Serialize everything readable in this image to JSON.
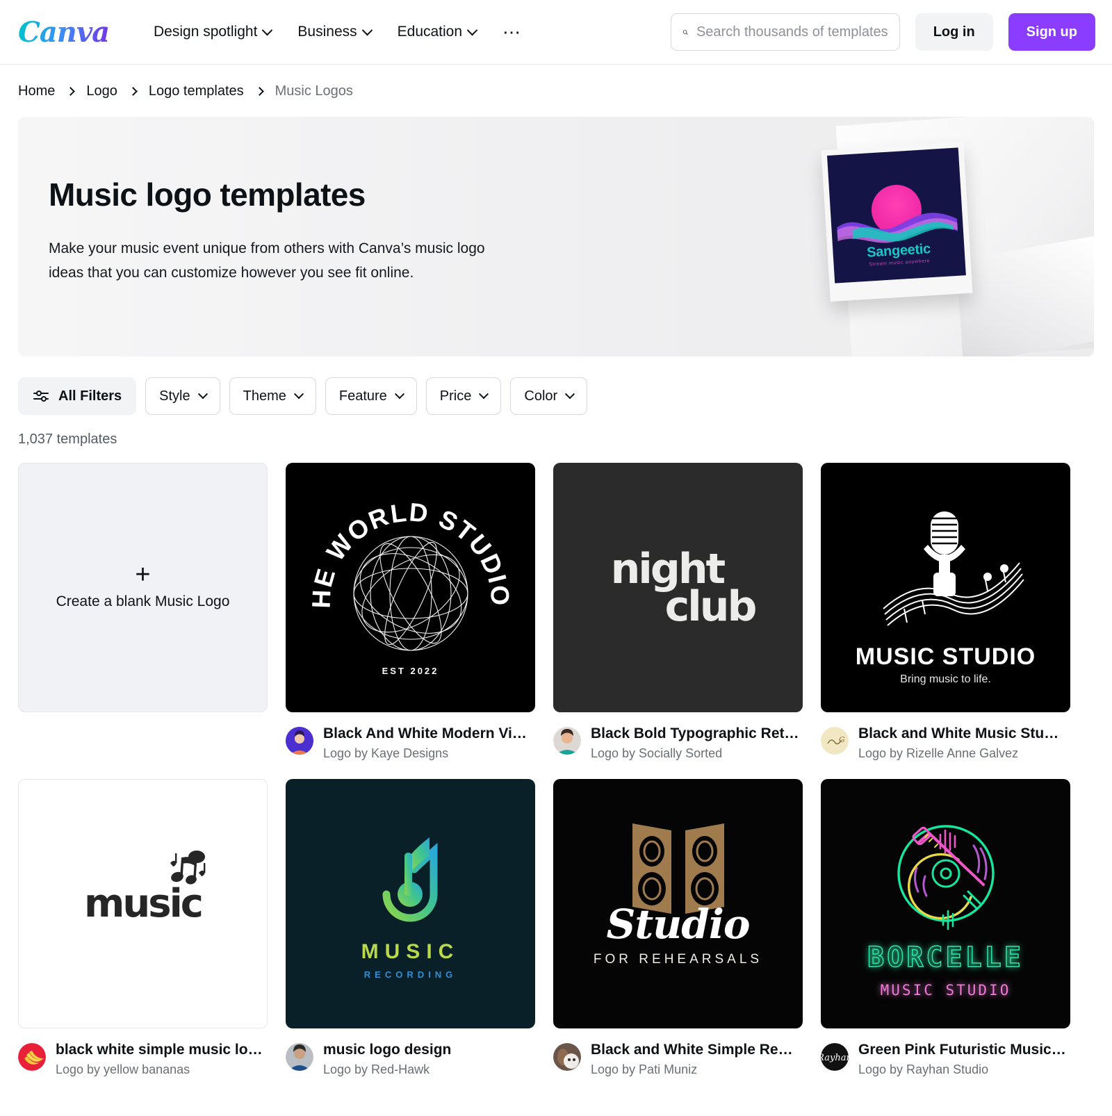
{
  "header": {
    "logo_text": "Canva",
    "nav": [
      {
        "label": "Design spotlight",
        "icon": "chevron-down-icon"
      },
      {
        "label": "Business",
        "icon": "chevron-down-icon"
      },
      {
        "label": "Education",
        "icon": "chevron-down-icon"
      }
    ],
    "more_icon": "ellipsis-icon",
    "search": {
      "icon": "search-icon",
      "placeholder": "Search thousands of templates",
      "value": ""
    },
    "login_label": "Log in",
    "signup_label": "Sign up",
    "signup_color": "#8b3dff"
  },
  "breadcrumb": [
    {
      "label": "Home"
    },
    {
      "label": "Logo"
    },
    {
      "label": "Logo templates"
    },
    {
      "label": "Music Logos"
    }
  ],
  "hero": {
    "title": "Music logo templates",
    "subtitle": "Make your music event unique from others with Canva’s music logo ideas that you can customize however you see fit online.",
    "artwork": {
      "brand": "Sangeetic",
      "tagline": "Stream music anywhere",
      "bg_color": "#141546",
      "brand_color": "#17c8c8",
      "tagline_color": "#b84fb0"
    }
  },
  "filters": {
    "all_filters_label": "All Filters",
    "all_filters_icon": "sliders-icon",
    "pills": [
      {
        "label": "Style",
        "icon": "chevron-down-icon"
      },
      {
        "label": "Theme",
        "icon": "chevron-down-icon"
      },
      {
        "label": "Feature",
        "icon": "chevron-down-icon"
      },
      {
        "label": "Price",
        "icon": "chevron-down-icon"
      },
      {
        "label": "Color",
        "icon": "chevron-down-icon"
      }
    ],
    "results_count": "1,037 templates"
  },
  "blank_card": {
    "icon": "plus-icon",
    "label": "Create a blank Music Logo"
  },
  "templates": [
    {
      "title": "Black And White Modern Vinta...",
      "author": "Logo by Kaye Designs",
      "art": {
        "kind": "world-studios",
        "bg": "#000000",
        "text_top": "THE WORLD STUDIOS",
        "text_bottom": "EST 2022"
      }
    },
    {
      "title": "Black Bold Typographic Retro ...",
      "author": "Logo by Socially Sorted",
      "art": {
        "kind": "night-club",
        "bg": "#2b2b2b",
        "line1": "night",
        "line2": "club"
      }
    },
    {
      "title": "Black and White Music Studio ...",
      "author": "Logo by Rizelle Anne Galvez",
      "art": {
        "kind": "music-studio-mic",
        "bg": "#000000",
        "title": "MUSIC STUDIO",
        "sub": "Bring music to life."
      }
    },
    {
      "title": "black white simple music logo",
      "author": "Logo by yellow bananas",
      "art": {
        "kind": "white-music",
        "bg": "#ffffff",
        "word": "music"
      }
    },
    {
      "title": "music logo design",
      "author": "Logo by Red-Hawk",
      "art": {
        "kind": "music-recording",
        "bg": "#0a2028",
        "title": "MUSIC",
        "sub": "RECORDING"
      }
    },
    {
      "title": "Black and White Simple Recor...",
      "author": "Logo by Pati Muniz",
      "art": {
        "kind": "studio-rehearsals",
        "bg": "#050505",
        "title": "Studio",
        "sub": "FOR REHEARSALS"
      }
    },
    {
      "title": "Green Pink Futuristic Music St...",
      "author": "Logo by Rayhan Studio",
      "art": {
        "kind": "borcelle-neon",
        "bg": "#050505",
        "title": "BORCELLE",
        "sub": "MUSIC STUDIO"
      }
    }
  ]
}
